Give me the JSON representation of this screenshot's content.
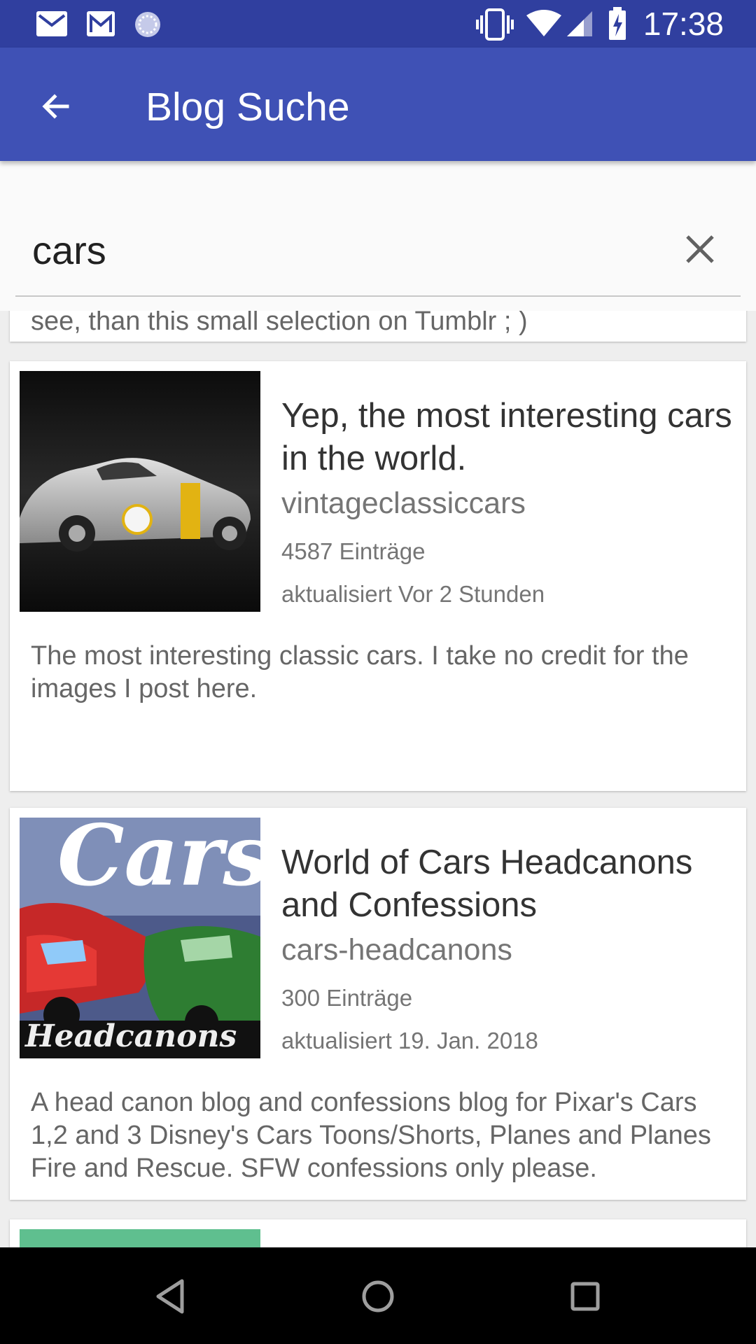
{
  "status_bar": {
    "time": "17:38",
    "icons": [
      "gmail-icon",
      "gmail-icon",
      "sync-icon",
      "vibrate-icon",
      "wifi-icon",
      "signal-icon",
      "battery-charging-icon"
    ]
  },
  "app_bar": {
    "title": "Blog Suche",
    "back_icon": "arrow-back-icon"
  },
  "search": {
    "value": "cars",
    "clear_icon": "close-icon"
  },
  "results": {
    "partial_top_text": "see, than this small selection on Tumblr ; )",
    "items": [
      {
        "title": "Yep, the most interesting cars in the world.",
        "name": "vintageclassiccars",
        "posts": "4587 Einträge",
        "updated": "aktualisiert Vor 2 Stunden",
        "description": "The most interesting classic cars. I take no credit for the images I post here."
      },
      {
        "title": "World of Cars Headcanons and Confessions",
        "name": "cars-headcanons",
        "posts": "300 Einträge",
        "updated": "aktualisiert 19. Jan. 2018",
        "description": "A head canon blog and confessions blog for Pixar's Cars 1,2 and 3 Disney's Cars Toons/Shorts, Planes and Planes Fire and Rescue. SFW confessions only please.",
        "thumb_text_top": "Cars",
        "thumb_text_bottom": "Headcanons"
      }
    ]
  },
  "nav_bar": {
    "icons": [
      "back-triangle-icon",
      "home-circle-icon",
      "recents-square-icon"
    ]
  },
  "colors": {
    "primary": "#3f51b5",
    "primary_dark": "#303f9f",
    "thumb_partial": "#5fbf8f"
  }
}
